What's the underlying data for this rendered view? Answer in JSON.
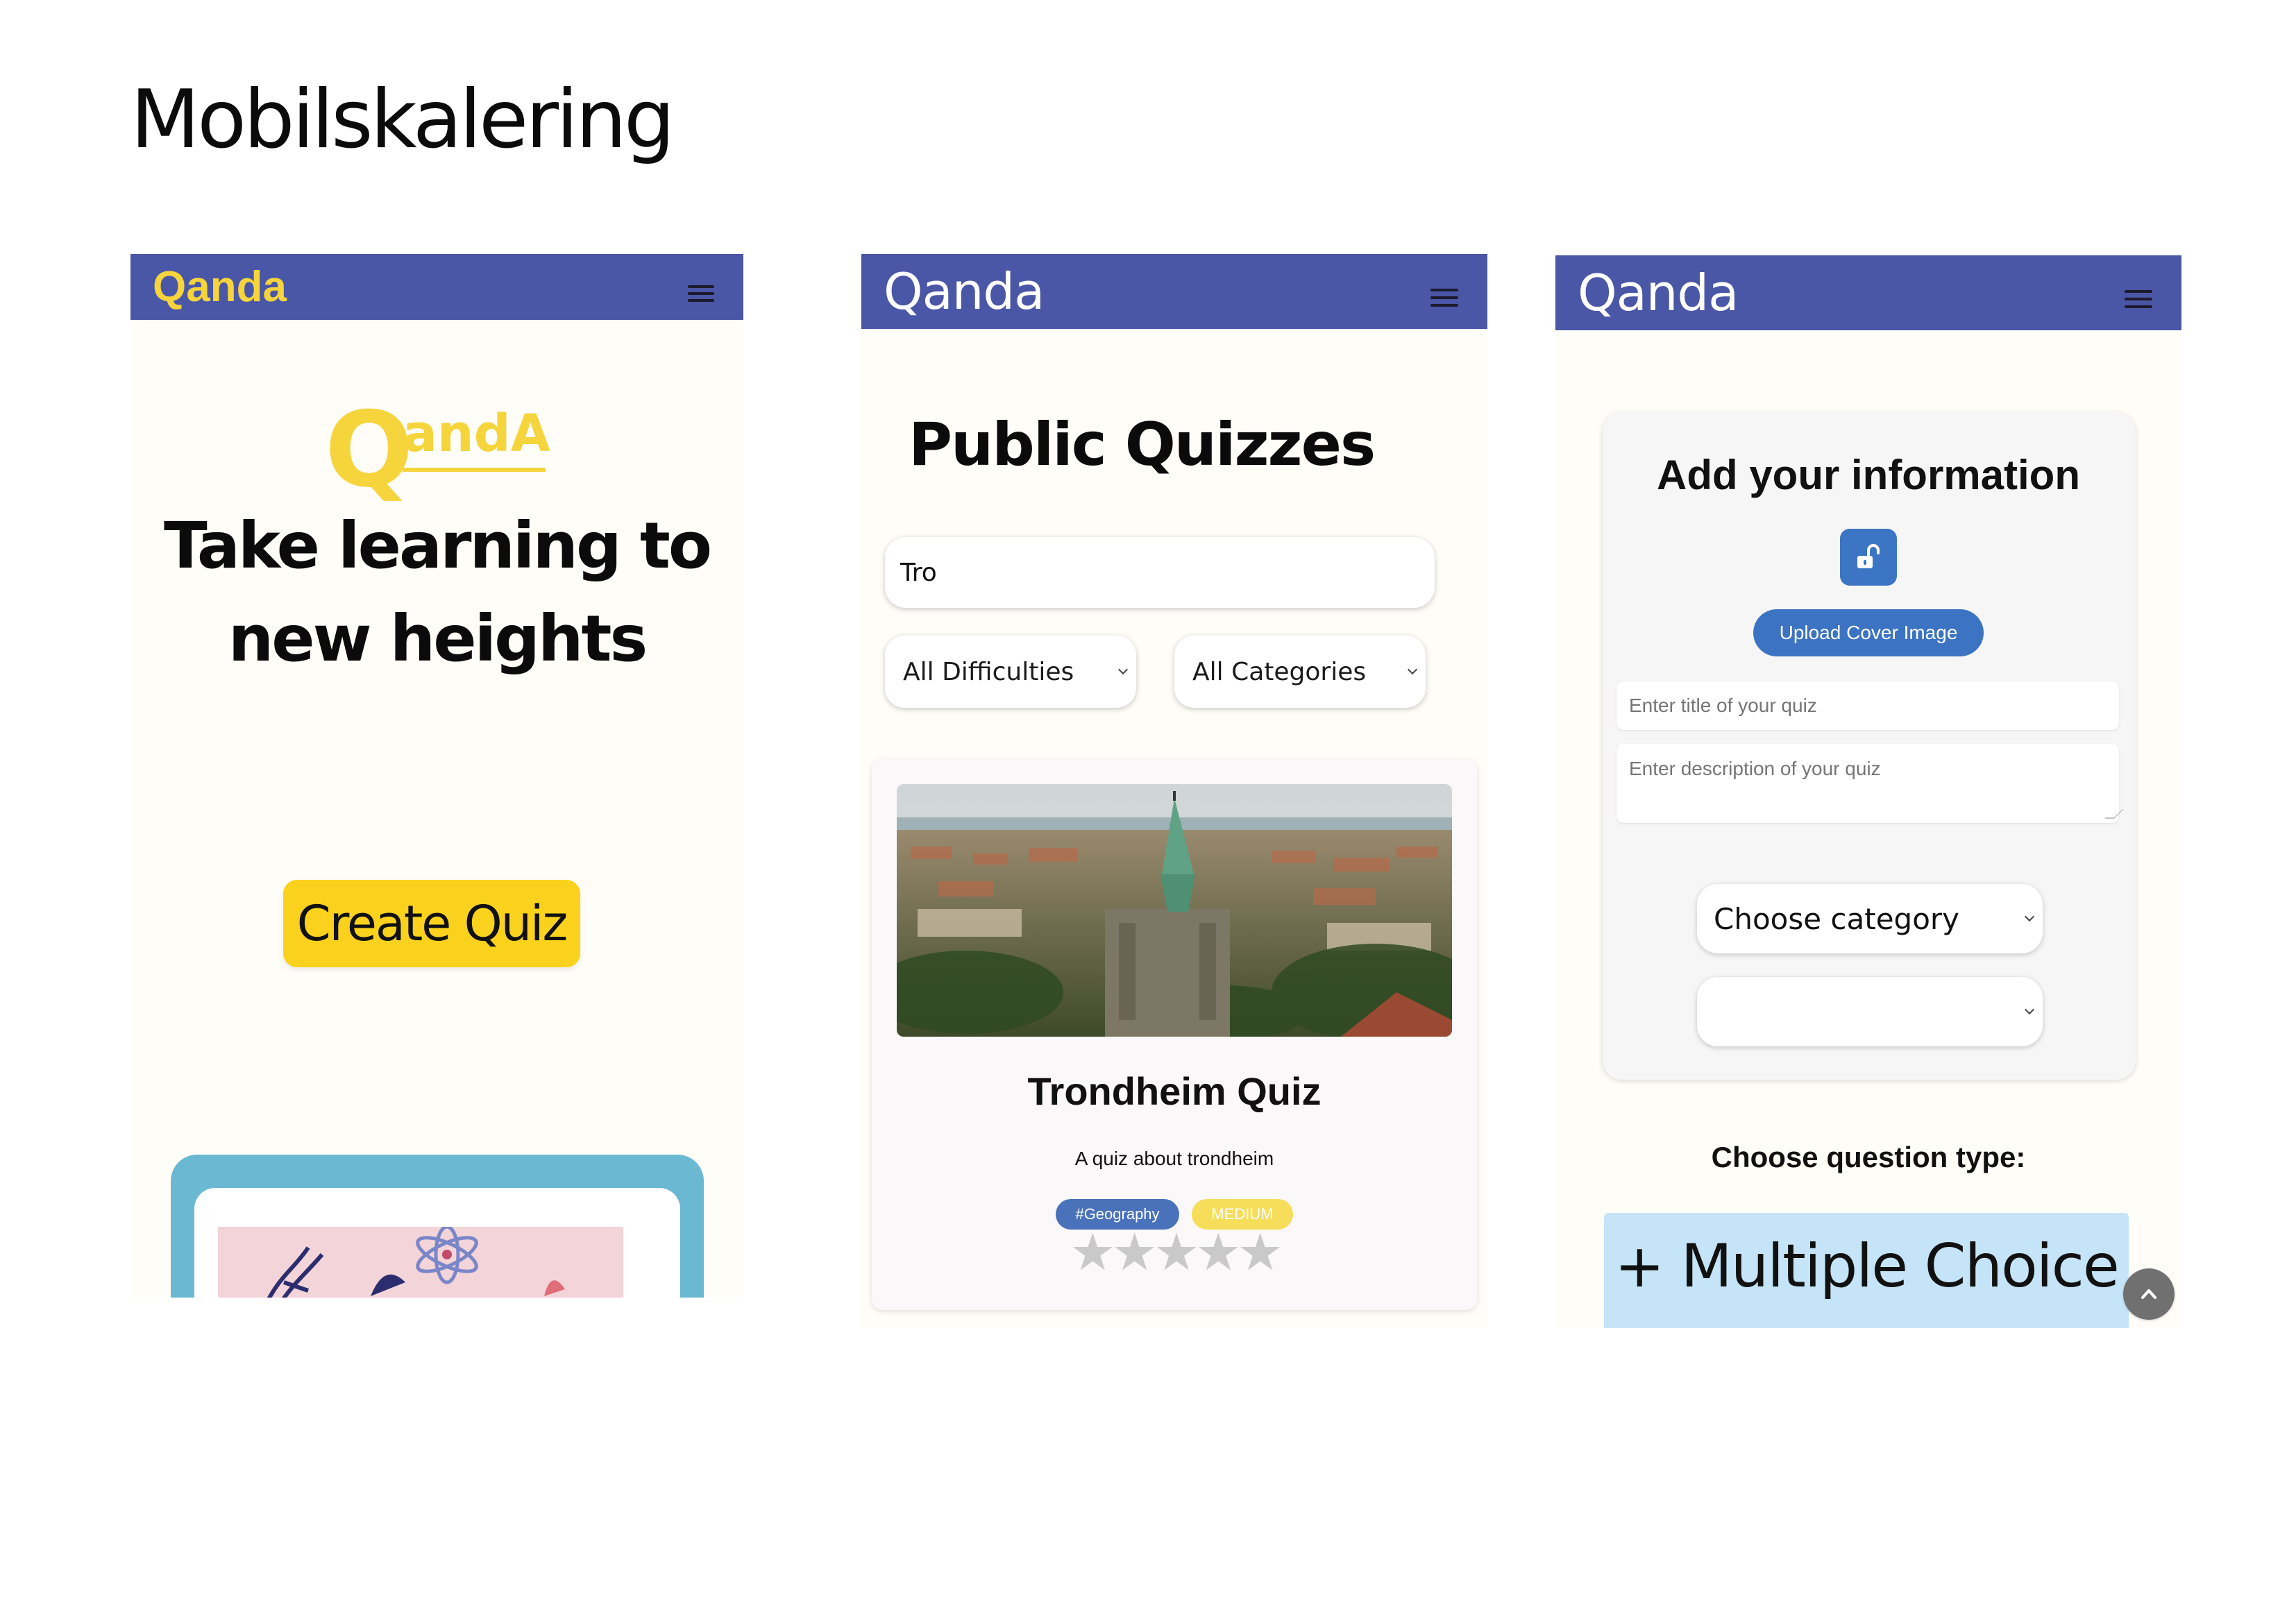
{
  "slide": {
    "title": "Mobilskalering"
  },
  "home": {
    "brand": "Qanda",
    "logo": {
      "q": "Q",
      "rest": "andA"
    },
    "headline_line1": "Take learning to",
    "headline_line2": "new heights",
    "create_button": "Create Quiz"
  },
  "public_quizzes": {
    "brand": "Qanda",
    "heading": "Public Quizzes",
    "search_value": "Tro",
    "difficulty_selected": "All Difficulties",
    "category_selected": "All Categories",
    "quiz": {
      "title": "Trondheim Quiz",
      "description": "A quiz about trondheim",
      "category_tag": "#Geography",
      "difficulty_tag": "MEDIUM",
      "stars": "★★★★★",
      "rating": 0
    }
  },
  "create_form": {
    "brand": "Qanda",
    "heading": "Add your information",
    "upload_button": "Upload Cover Image",
    "title_placeholder": "Enter title of your quiz",
    "description_placeholder": "Enter description of your quiz",
    "category_selected": "Choose category",
    "difficulty_selected": "",
    "question_type_label": "Choose question type:",
    "multiple_choice_tile": "+ Multiple Choice"
  },
  "colors": {
    "navbar": "#4a56a6",
    "brand_yellow": "#f6d43c",
    "create_button": "#fad21d",
    "tag_category": "#4a72bb",
    "tag_difficulty": "#f6dd5a",
    "upload_button": "#3c73c2",
    "multiple_choice_tile": "#c6e4f7"
  },
  "icons": [
    "menu-icon",
    "unlock-icon",
    "chevron-down-icon",
    "arrow-up-icon",
    "star-icon"
  ]
}
